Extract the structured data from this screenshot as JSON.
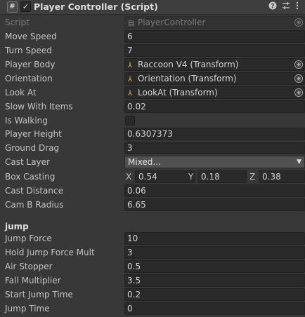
{
  "header": {
    "component_icon": "#",
    "enabled_check": "✓",
    "title": "Player Controller (Script)",
    "help_icon": "help-icon",
    "settings_icon": "sliders-icon",
    "menu_icon": "kebab-menu-icon"
  },
  "script": {
    "label": "Script",
    "value": "PlayerController"
  },
  "fields": {
    "move_speed": {
      "label": "Move Speed",
      "value": "6"
    },
    "turn_speed": {
      "label": "Turn Speed",
      "value": "7"
    },
    "player_body": {
      "label": "Player Body",
      "value": "Raccoon V4 (Transform)"
    },
    "orientation": {
      "label": "Orientation",
      "value": "Orientation (Transform)"
    },
    "look_at": {
      "label": "Look At",
      "value": "LookAt (Transform)"
    },
    "slow_with_items": {
      "label": "Slow With Items",
      "value": "0.02"
    },
    "is_walking": {
      "label": "Is Walking",
      "checked": false
    },
    "player_height": {
      "label": "Player Height",
      "value": "0.6307373"
    },
    "ground_drag": {
      "label": "Ground Drag",
      "value": "3"
    },
    "cast_layer": {
      "label": "Cast Layer",
      "value": "Mixed..."
    },
    "box_casting": {
      "label": "Box Casting",
      "x_label": "X",
      "x": "0.54",
      "y_label": "Y",
      "y": "0.18",
      "z_label": "Z",
      "z": "0.38"
    },
    "cast_distance": {
      "label": "Cast Distance",
      "value": "0.06"
    },
    "cam_b_radius": {
      "label": "Cam B Radius",
      "value": "6.65"
    }
  },
  "jump_section": {
    "title": "jump",
    "jump_force": {
      "label": "Jump Force",
      "value": "10"
    },
    "hold_jump_force_mult": {
      "label": "Hold Jump Force Mult",
      "value": "3"
    },
    "air_stopper": {
      "label": "Air Stopper",
      "value": "0.5"
    },
    "fall_multiplier": {
      "label": "Fall Multiplier",
      "value": "3.5"
    },
    "start_jump_time": {
      "label": "Start Jump Time",
      "value": "0.2"
    },
    "jump_time": {
      "label": "Jump Time",
      "value": "0"
    }
  }
}
